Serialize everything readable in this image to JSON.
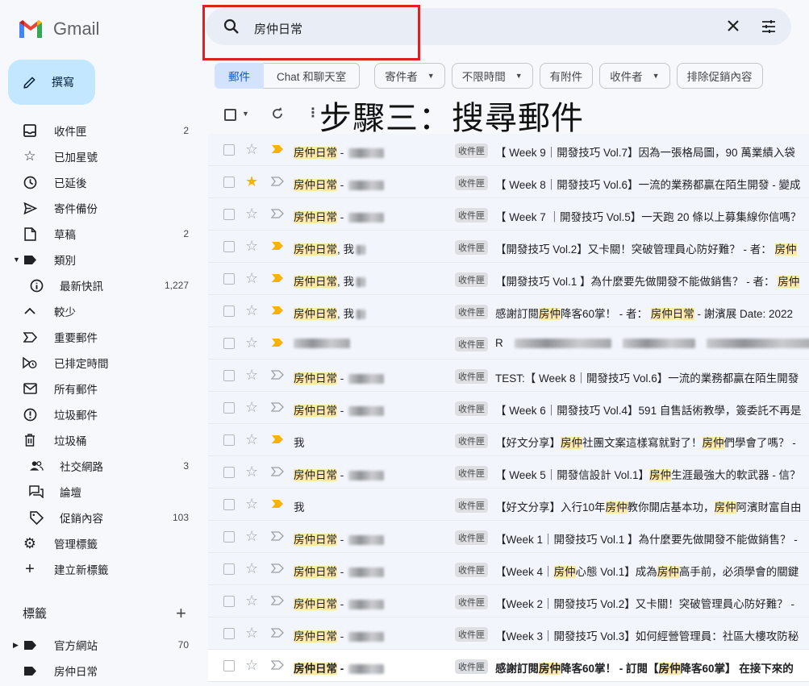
{
  "app": {
    "name": "Gmail"
  },
  "compose": {
    "label": "撰寫"
  },
  "search": {
    "query": "房仲日常"
  },
  "step_title": "步驟三：搜尋郵件",
  "nav": [
    {
      "label": "收件匣",
      "count": "2",
      "icon": "inbox-icon"
    },
    {
      "label": "已加星號",
      "count": "",
      "icon": "star-icon"
    },
    {
      "label": "已延後",
      "count": "",
      "icon": "clock-icon"
    },
    {
      "label": "寄件備份",
      "count": "",
      "icon": "send-icon"
    },
    {
      "label": "草稿",
      "count": "2",
      "icon": "draft-icon"
    },
    {
      "label": "類別",
      "count": "",
      "icon": "label-icon"
    },
    {
      "label": "最新快訊",
      "count": "1,227",
      "icon": "info-icon"
    },
    {
      "label": "較少",
      "count": "",
      "icon": "chevron-up-icon"
    },
    {
      "label": "重要郵件",
      "count": "",
      "icon": "important-icon"
    },
    {
      "label": "已排定時間",
      "count": "",
      "icon": "scheduled-icon"
    },
    {
      "label": "所有郵件",
      "count": "",
      "icon": "mail-icon"
    },
    {
      "label": "垃圾郵件",
      "count": "",
      "icon": "spam-icon"
    },
    {
      "label": "垃圾桶",
      "count": "",
      "icon": "trash-icon"
    },
    {
      "label": "社交網路",
      "count": "3",
      "icon": "people-icon"
    },
    {
      "label": "論壇",
      "count": "",
      "icon": "forum-icon"
    },
    {
      "label": "促銷內容",
      "count": "103",
      "icon": "tag-icon"
    },
    {
      "label": "管理標籤",
      "count": "",
      "icon": "gear-icon"
    },
    {
      "label": "建立新標籤",
      "count": "",
      "icon": "plus-icon"
    }
  ],
  "labels_section": {
    "title": "標籤"
  },
  "user_labels": [
    {
      "label": "官方網站",
      "count": "70"
    },
    {
      "label": "房仲日常",
      "count": ""
    }
  ],
  "tabs": [
    {
      "label": "郵件"
    },
    {
      "label": "Chat 和聊天室"
    }
  ],
  "filters": [
    "寄件者",
    "不限時間",
    "有附件",
    "收件者",
    "排除促銷內容"
  ],
  "folder_tag": "收件匣",
  "emails": [
    {
      "sender": "房仲日常",
      "subject": "【 Week 9｜開發技巧 Vol.7】因為一張格局圖，90 萬業績入袋"
    },
    {
      "sender": "房仲日常",
      "subject": "【 Week 8｜開發技巧 Vol.6】一流的業務都贏在陌生開發 - 變成"
    },
    {
      "sender": "房仲日常",
      "subject": "【 Week 7 ｜開發技巧 Vol.5】一天跑 20 條以上募集線你信嗎？"
    },
    {
      "sender": "房仲日常, 我",
      "subject": "【開發技巧 Vol.2】又卡關！突破管理員心防好難？ - 者： 房仲"
    },
    {
      "sender": "房仲日常, 我",
      "subject": "【開發技巧 Vol.1 】為什麼要先做開發不能做銷售？ - 者： 房仲"
    },
    {
      "sender": "房仲日常, 我",
      "subject": "感謝訂閱房仲降客60掌！ - 者： 房仲日常 - 謝濱展 Date: 2022"
    },
    {
      "sender": "",
      "subject": "R"
    },
    {
      "sender": "房仲日常",
      "subject": "TEST:【 Week 8｜開發技巧 Vol.6】一流的業務都贏在陌生開發"
    },
    {
      "sender": "房仲日常",
      "subject": "【 Week 6｜開發技巧 Vol.4】591 自售話術教學，簽委託不再是"
    },
    {
      "sender": "我",
      "subject": "【好文分享】房仲社團文案這樣寫就對了！房仲們學會了嗎？ -"
    },
    {
      "sender": "房仲日常",
      "subject": "【 Week 5｜開發信設計 Vol.1】房仲生涯最強大的軟武器 - 信？"
    },
    {
      "sender": "我",
      "subject": "【好文分享】入行10年房仲教你開店基本功，房仲阿濱財富自由"
    },
    {
      "sender": "房仲日常",
      "subject": "【Week 1｜開發技巧 Vol.1 】為什麼要先做開發不能做銷售？ -"
    },
    {
      "sender": "房仲日常",
      "subject": "【Week 4｜房仲心態 Vol.1】成為房仲高手前，必須學會的關鍵"
    },
    {
      "sender": "房仲日常",
      "subject": "【Week 2｜開發技巧 Vol.2】又卡關！突破管理員心防好難？ -"
    },
    {
      "sender": "房仲日常",
      "subject": "【Week 3｜開發技巧 Vol.3】如何經營管理員：社區大樓攻防秘"
    },
    {
      "sender": "房仲日常",
      "subject": "感謝訂閱房仲降客60掌！ - 訂閱【房仲降客60掌】 在接下來的"
    }
  ],
  "colors": {
    "compose_bg": "#c2e7ff",
    "highlight": "#fce8a8",
    "star": "#f4b400",
    "important": "#f4b400",
    "annotation_box": "#e02020",
    "active_tab": "#d3e3fd"
  }
}
